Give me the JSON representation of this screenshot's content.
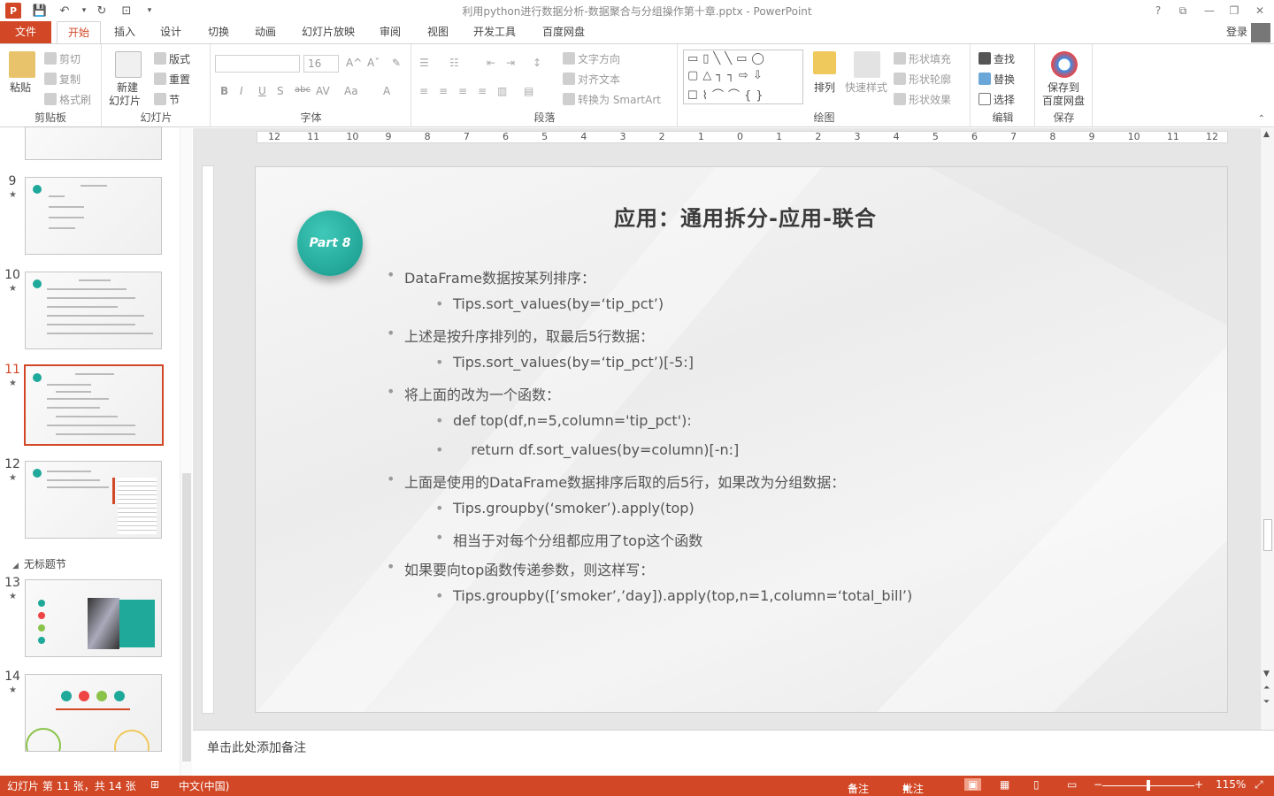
{
  "window": {
    "title": "利用python进行数据分析-数据聚合与分组操作第十章.pptx - PowerPoint",
    "app_icon": "P",
    "controls": [
      "?",
      "⧉",
      "—",
      "❐",
      "✕"
    ]
  },
  "tabs": {
    "file": "文件",
    "items": [
      "开始",
      "插入",
      "设计",
      "切换",
      "动画",
      "幻灯片放映",
      "审阅",
      "视图",
      "开发工具",
      "百度网盘"
    ],
    "active": "开始",
    "login": "登录"
  },
  "ribbon": {
    "clipboard": {
      "paste": "粘贴",
      "cut": "剪切",
      "copy": "复制",
      "format_painter": "格式刷",
      "label": "剪贴板"
    },
    "slides": {
      "new_slide_1": "新建",
      "new_slide_2": "幻灯片",
      "layout": "版式",
      "reset": "重置",
      "section": "节",
      "label": "幻灯片"
    },
    "font": {
      "size": "16",
      "bold": "B",
      "italic": "I",
      "underline": "U",
      "shadow": "S",
      "strike": "abc",
      "spacing": "AV",
      "case": "Aa",
      "color": "A",
      "label": "字体"
    },
    "paragraph": {
      "text_direction": "文字方向",
      "align_text": "对齐文本",
      "smartart": "转换为 SmartArt",
      "label": "段落"
    },
    "drawing": {
      "arrange": "排列",
      "quick_styles": "快速样式",
      "shape_fill": "形状填充",
      "shape_outline": "形状轮廓",
      "shape_effect": "形状效果",
      "label": "绘图"
    },
    "editing": {
      "find": "查找",
      "replace": "替换",
      "select": "选择",
      "label": "编辑"
    },
    "save": {
      "line1": "保存到",
      "line2": "百度网盘",
      "label": "保存"
    }
  },
  "thumbnails": {
    "slides": [
      {
        "num": "9"
      },
      {
        "num": "10"
      },
      {
        "num": "11",
        "active": true
      },
      {
        "num": "12"
      },
      {
        "num": "13"
      },
      {
        "num": "14"
      }
    ],
    "section": "无标题节",
    "star": "★"
  },
  "slide": {
    "title": "应用：通用拆分-应用-联合",
    "badge": "Part 8",
    "bullets": [
      {
        "level": 1,
        "text": "DataFrame数据按某列排序："
      },
      {
        "level": 2,
        "text": "Tips.sort_values(by=‘tip_pct’)"
      },
      {
        "level": 1,
        "text": "上述是按升序排列的，取最后5行数据："
      },
      {
        "level": 2,
        "text": "Tips.sort_values(by=‘tip_pct’)[-5:]"
      },
      {
        "level": 1,
        "text": "将上面的改为一个函数："
      },
      {
        "level": 2,
        "text": "def top(df,n=5,column='tip_pct'):"
      },
      {
        "level": 2,
        "text": "    return df.sort_values(by=column)[-n:]"
      },
      {
        "level": 1,
        "text": "上面是使用的DataFrame数据排序后取的后5行，如果改为分组数据："
      },
      {
        "level": 2,
        "text": "Tips.groupby(‘smoker’).apply(top)"
      },
      {
        "level": 2,
        "text": "相当于对每个分组都应用了top这个函数"
      },
      {
        "level": 1,
        "text": "如果要向top函数传递参数，则这样写："
      },
      {
        "level": 2,
        "text": "Tips.groupby([‘smoker’,’day]).apply(top,n=1,column=‘total_bill’)"
      }
    ]
  },
  "ruler": {
    "horizontal": [
      "12",
      "11",
      "10",
      "9",
      "8",
      "7",
      "6",
      "5",
      "4",
      "3",
      "2",
      "1",
      "0",
      "1",
      "2",
      "3",
      "4",
      "5",
      "6",
      "7",
      "8",
      "9",
      "10",
      "11",
      "12"
    ]
  },
  "notes": {
    "placeholder": "单击此处添加备注"
  },
  "status": {
    "slide_info": "幻灯片 第 11 张，共 14 张",
    "language": "中文(中国)",
    "notes": "备注",
    "comments": "批注",
    "zoom": "115%"
  }
}
